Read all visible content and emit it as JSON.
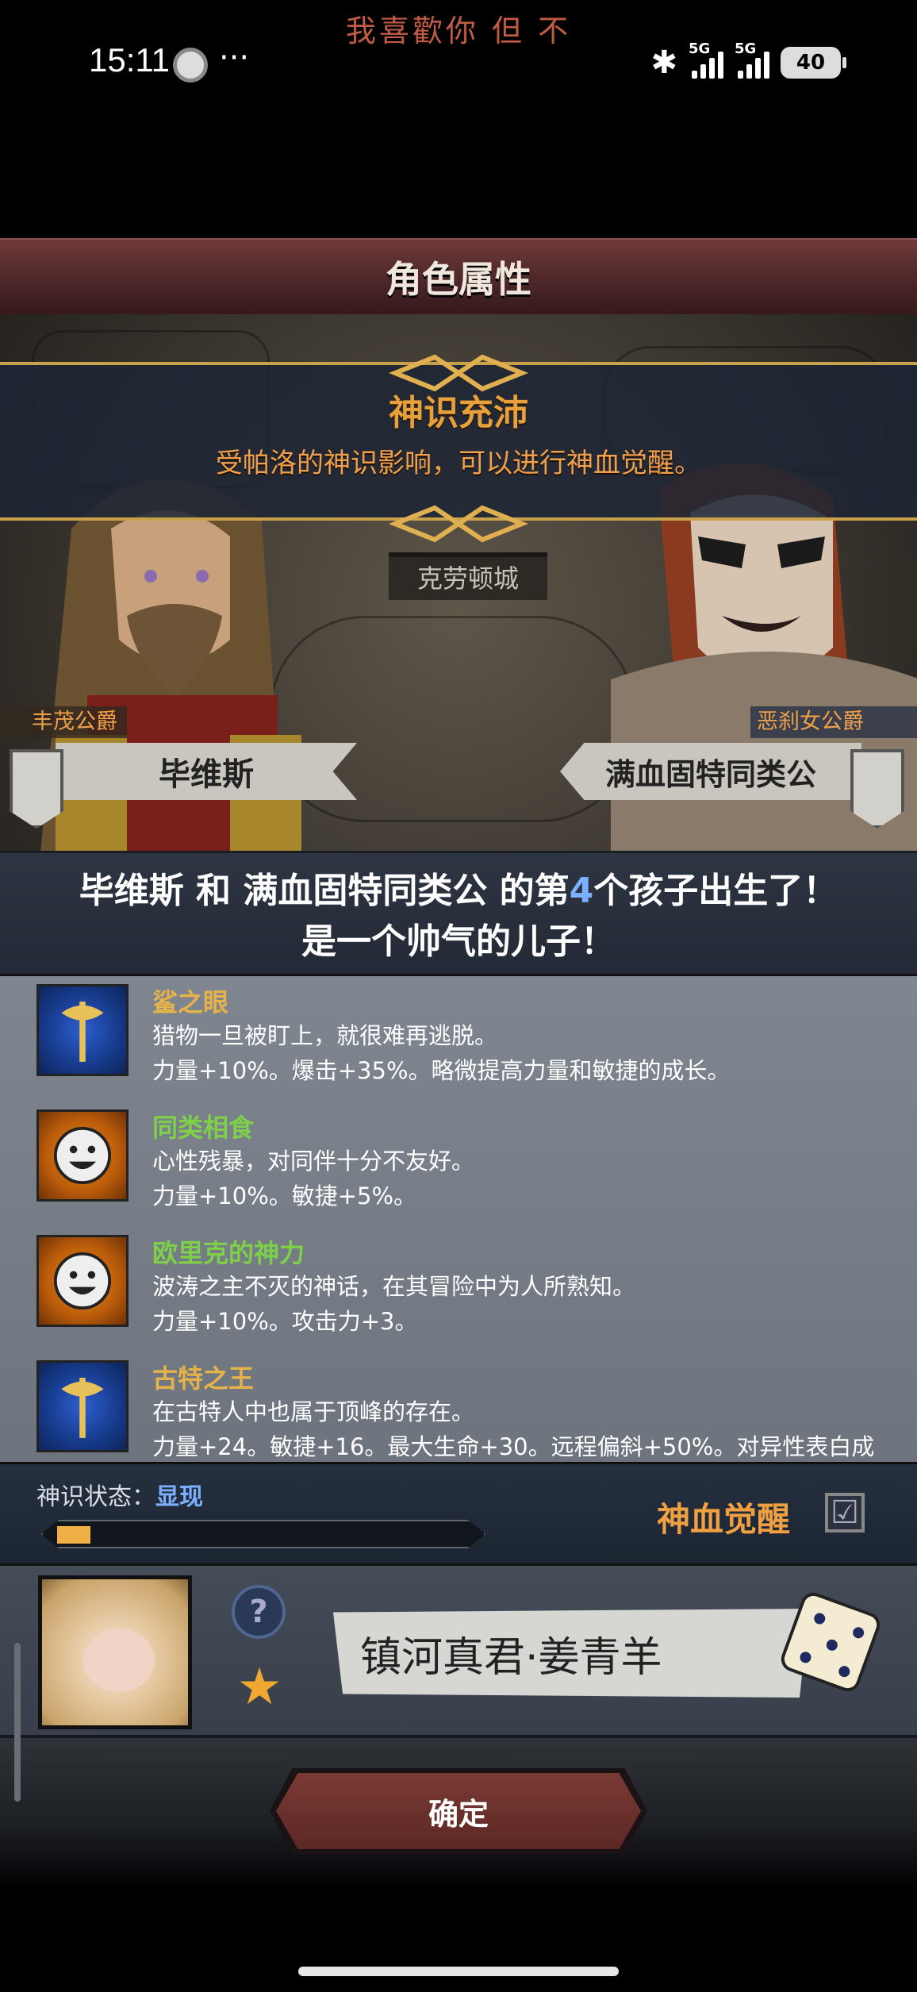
{
  "status_bar": {
    "now_playing": "我喜歡你 但 不",
    "time": "15:11",
    "more": "···",
    "network1": "5G",
    "network2": "5G",
    "battery": "40"
  },
  "header": {
    "title": "角色属性"
  },
  "banner": {
    "title": "神识充沛",
    "subtitle": "受帕洛的神识影响，可以进行神血觉醒。"
  },
  "scene": {
    "city": "克劳顿城",
    "left_title": "丰茂公爵",
    "left_name": "毕维斯",
    "right_title": "恶刹女公爵",
    "right_name": "满血固特同类公"
  },
  "announcement": {
    "line1_pre": "毕维斯 和 满血固特同类公 的第",
    "line1_num": "4",
    "line1_post": "个孩子出生了！",
    "line2": "是一个帅气的儿子！"
  },
  "traits": [
    {
      "name": "鲨之眼",
      "color": "#e6b34a",
      "icon": "axe-icon",
      "desc": "猎物一旦被盯上，就很难再逃脱。",
      "stat": "力量+10%。爆击+35%。略微提高力量和敏捷的成长。"
    },
    {
      "name": "同类相食",
      "color": "#7ed04a",
      "icon": "smiley-icon",
      "desc": "心性残暴，对同伴十分不友好。",
      "stat": "力量+10%。敏捷+5%。"
    },
    {
      "name": "欧里克的神力",
      "color": "#7ed04a",
      "icon": "smiley-icon",
      "desc": "波涛之主不灭的神话，在其冒险中为人所熟知。",
      "stat": "力量+10%。攻击力+3。"
    },
    {
      "name": "古特之王",
      "color": "#e6b34a",
      "icon": "axe-icon",
      "desc": "在古特人中也属于顶峰的存在。",
      "stat": "力量+24。敏捷+16。最大生命+30。远程偏斜+50%。对异性表白成"
    }
  ],
  "awakening": {
    "label": "神识状态：",
    "state": "显现",
    "progress": 0.08,
    "title": "神血觉醒",
    "checked": "☑"
  },
  "child": {
    "help": "?",
    "star": "★",
    "name": "镇河真君·姜青羊"
  },
  "footer": {
    "confirm": "确定"
  }
}
